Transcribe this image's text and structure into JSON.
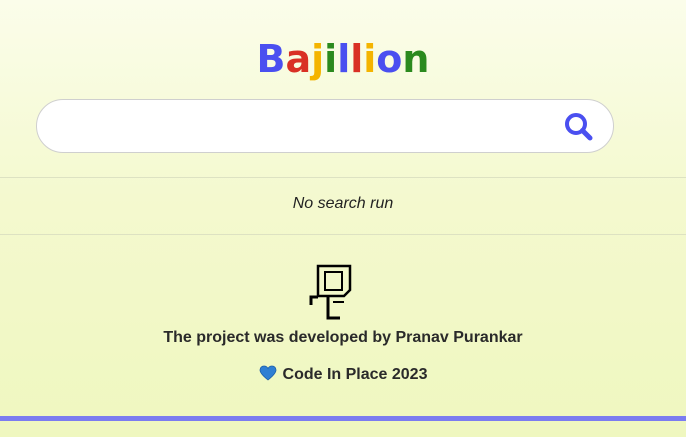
{
  "header": {
    "logo_letters": [
      {
        "char": "B",
        "color": "#4a4ff0"
      },
      {
        "char": "a",
        "color": "#d93025"
      },
      {
        "char": "j",
        "color": "#f4b400"
      },
      {
        "char": "i",
        "color": "#2b8a1e"
      },
      {
        "char": "l",
        "color": "#4a4ff0"
      },
      {
        "char": "l",
        "color": "#d93025"
      },
      {
        "char": "i",
        "color": "#f4b400"
      },
      {
        "char": "o",
        "color": "#4a4ff0"
      },
      {
        "char": "n",
        "color": "#2b8a1e"
      }
    ]
  },
  "search": {
    "value": "",
    "placeholder": "",
    "button_icon": "search-icon",
    "accent_color": "#4a4ff0"
  },
  "results": {
    "status_text": "No search run"
  },
  "footer": {
    "logo_icon": "code-in-place-karel-icon",
    "credit_text": "The project was developed by Pranav Purankar",
    "event_icon": "blue-heart-icon",
    "event_text": "Code In Place 2023",
    "bar_color": "#7b7cf0"
  }
}
